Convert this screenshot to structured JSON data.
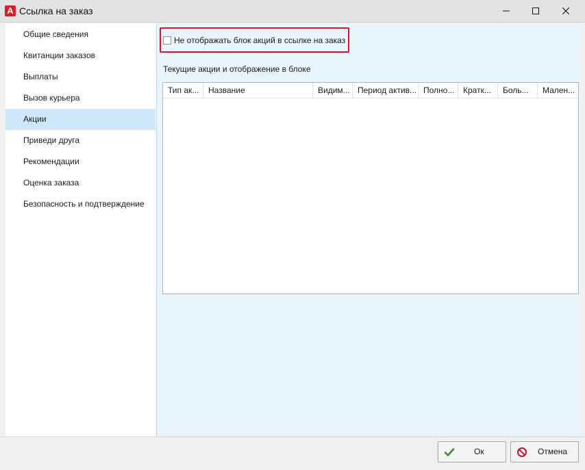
{
  "window": {
    "title": "Ссылка на заказ",
    "app_icon": "А"
  },
  "sidebar": {
    "items": [
      {
        "label": "Общие сведения"
      },
      {
        "label": "Квитанции заказов"
      },
      {
        "label": "Выплаты"
      },
      {
        "label": "Вызов курьера"
      },
      {
        "label": "Акции",
        "active": true
      },
      {
        "label": "Приведи друга"
      },
      {
        "label": "Рекомендации"
      },
      {
        "label": "Оценка заказа"
      },
      {
        "label": "Безопасность и подтверждение"
      }
    ]
  },
  "main": {
    "checkbox_label": "Не отображать блок акций в ссылке на заказ",
    "checkbox_checked": false,
    "section_label": "Текущие акции и отображение в блоке",
    "grid": {
      "columns": [
        "Тип ак...",
        "Название",
        "Видим...",
        "Период актив...",
        "Полно...",
        "Кратк...",
        "Боль...",
        "Мален..."
      ],
      "rows": []
    }
  },
  "footer": {
    "ok_label": "Ок",
    "cancel_label": "Отмена"
  },
  "colors": {
    "highlight_border": "#d9141e",
    "active_item_bg": "#cde8fb",
    "main_bg": "#e8f5fc",
    "ok_icon": "#2e8b2e",
    "cancel_icon": "#c8102e"
  }
}
